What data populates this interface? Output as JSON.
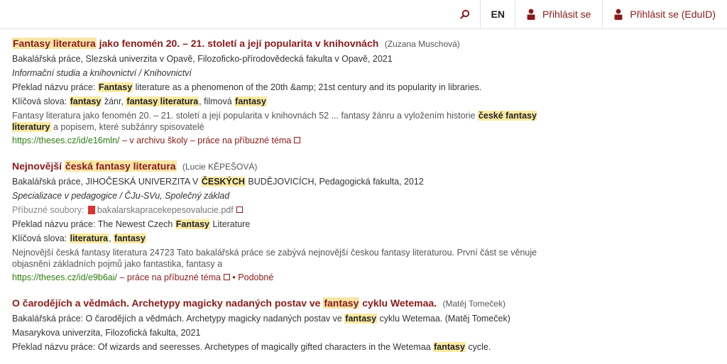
{
  "topnav": {
    "lang": "EN",
    "login": "Přihlásit se",
    "login_eduid": "Přihlásit se (EduID)"
  },
  "results": [
    {
      "title_hl": "Fantasy literatura",
      "title_rest": " jako fenomén 20. – 21. století a její popularita v knihovnách",
      "author": "(Zuzana Muschová)",
      "type": "Bakalářská práce, Slezská univerzita v Opavě, Filozoficko-přírodovědecká fakulta v Opavě, 2021",
      "field": "Informační studia a knihovnictví / Knihovnictví",
      "translation_label": "Překlad názvu práce: ",
      "translation_hl": "Fantasy",
      "translation_rest": " literature as a phenomenon of the 20th &amp; 21st century and its popularity in libraries.",
      "keywords_label": "Klíčová slova: ",
      "kw1": "fantasy",
      "kw2": " žánr, ",
      "kw3": "fantasy literatura",
      "kw4": ", filmová ",
      "kw5": "fantasy",
      "snippet_a": "Fantasy literatura jako fenomén 20. – 21. století a její popularita v knihovnách 52 ... fantasy žánru a vyložením historie ",
      "snippet_hl": "české fantasy literatury",
      "snippet_b": " a popisem, které subžánry spisovatelé",
      "url": "https://theses.cz/id/e16mln/",
      "archive": " – v archivu školy ",
      "related": " – práce na příbuzné téma"
    },
    {
      "title_a": "Nejnovější ",
      "title_hl": "česká fantasy literatura",
      "author": "(Lucie KĚPEŠOVÁ)",
      "type_a": "Bakalářská práce, JIHOČESKÁ UNIVERZITA V ",
      "type_hl": "ČESKÝCH",
      "type_b": " BUDĚJOVICÍCH, Pedagogická fakulta, 2012",
      "field": "Specializace v pedagogice / ČJu-SVu, Společný základ",
      "files_label": "Příbuzné soubory: ",
      "file": "bakalarskapracekepesovalucie.pdf",
      "translation_label": "Překlad názvu práce: ",
      "translation_a": "The Newest Czech ",
      "translation_hl": "Fantasy",
      "translation_b": " Literature",
      "keywords_label": "Klíčová slova: ",
      "kw1": "literatura",
      "kw2": ", ",
      "kw3": "fantasy",
      "snippet": "Nejnovější česká fantasy literatura 24723 Tato bakalářská práce se zabývá nejnovější českou fantasy literaturou. První část se věnuje objasnění základních pojmů jako fantastika, fantasy a",
      "url": "https://theses.cz/id/e9b6ai/",
      "related": " – práce na příbuzné téma",
      "similar": " • Podobné"
    },
    {
      "title_a": "O čarodějích a vědmách. Archetypy magicky nadaných postav ve ",
      "title_hl": "fantasy",
      "title_b": " cyklu Wetemaa.",
      "author": "(Matěj Tomeček)",
      "type_a": "Bakalářská práce: O čarodějích a vědmách. Archetypy magicky nadaných postav ve ",
      "type_hl": "fantasy",
      "type_b": " cyklu Wetemaa.  (Matěj Tomeček)",
      "school": "Masarykova univerzita, Filozofická fakulta, 2021",
      "translation_label": "Překlad názvu práce: ",
      "translation_a": "Of wizards and seeresses. Archetypes of magically gifted characters in the Wetemaa ",
      "translation_hl": "fantasy",
      "translation_b": " cycle."
    }
  ]
}
